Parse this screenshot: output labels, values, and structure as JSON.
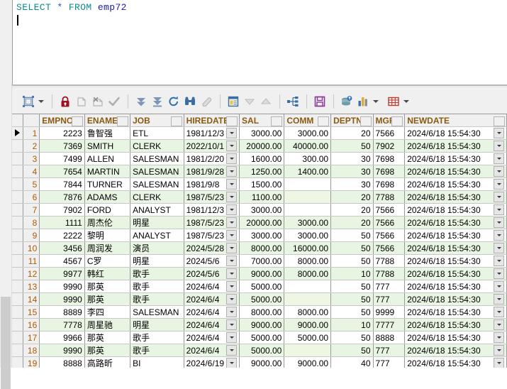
{
  "editor": {
    "sql_keyword1": "SELECT",
    "sql_star": "*",
    "sql_keyword2": "FROM",
    "sql_table": "emp72",
    "full_sql": "SELECT * FROM emp72"
  },
  "toolbar": {
    "buttons": [
      {
        "name": "edit-data-button",
        "icon": "edit-data-icon",
        "label": "Edit data"
      },
      {
        "name": "edit-data-dropdown",
        "icon": "chevron-down-icon",
        "label": "Edit data options"
      },
      {
        "name": "lock-button",
        "icon": "lock-icon",
        "label": "Lock"
      },
      {
        "name": "insert-record-button",
        "icon": "new-record-icon",
        "label": "Insert record"
      },
      {
        "name": "delete-record-button",
        "icon": "delete-record-icon",
        "label": "Delete record"
      },
      {
        "name": "post-edit-button",
        "icon": "checkmark-icon",
        "label": "Post edit"
      },
      {
        "name": "fetch-next-button",
        "icon": "fetch-next-icon",
        "label": "Fetch next page"
      },
      {
        "name": "fetch-all-button",
        "icon": "fetch-all-icon",
        "label": "Fetch all"
      },
      {
        "name": "refresh-button",
        "icon": "refresh-icon",
        "label": "Refresh"
      },
      {
        "name": "find-button",
        "icon": "binoculars-icon",
        "label": "Find"
      },
      {
        "name": "clear-filter-button",
        "icon": "eraser-icon",
        "label": "Clear filter"
      },
      {
        "name": "single-record-view-button",
        "icon": "form-view-icon",
        "label": "Single record view"
      },
      {
        "name": "move-down-button",
        "icon": "triangle-down-icon",
        "label": "Move down"
      },
      {
        "name": "move-up-button",
        "icon": "triangle-up-icon",
        "label": "Move up"
      },
      {
        "name": "hierarchy-button",
        "icon": "hierarchy-icon",
        "label": "Structure"
      },
      {
        "name": "export-button",
        "icon": "save-icon",
        "label": "Export"
      },
      {
        "name": "database-info-button",
        "icon": "database-icon",
        "label": "Database info"
      },
      {
        "name": "chart-button",
        "icon": "bar-chart-icon",
        "label": "Chart"
      },
      {
        "name": "chart-dropdown",
        "icon": "chevron-down-icon",
        "label": "Chart options"
      },
      {
        "name": "grid-button",
        "icon": "grid-icon",
        "label": "Grid"
      },
      {
        "name": "grid-dropdown",
        "icon": "chevron-down-icon",
        "label": "Grid options"
      }
    ]
  },
  "grid": {
    "columns": [
      "EMPNO",
      "ENAME",
      "JOB",
      "HIREDATE",
      "SAL",
      "COMM",
      "DEPTNO",
      "MGR",
      "NEWDATE"
    ],
    "current_row": 1,
    "rows": [
      {
        "n": "1",
        "EMPNO": "2223",
        "ENAME": "鲁智强",
        "JOB": "ETL",
        "HIREDATE": "1981/12/3",
        "SAL": "3000.00",
        "COMM": "3000.00",
        "DEPTNO": "20",
        "MGR": "7566",
        "NEWDATE": "2024/6/18 15:54:30"
      },
      {
        "n": "2",
        "EMPNO": "7369",
        "ENAME": "SMITH",
        "JOB": "CLERK",
        "HIREDATE": "2022/10/1",
        "SAL": "20000.00",
        "COMM": "40000.00",
        "DEPTNO": "50",
        "MGR": "7902",
        "NEWDATE": "2024/6/18 15:54:30"
      },
      {
        "n": "3",
        "EMPNO": "7499",
        "ENAME": "ALLEN",
        "JOB": "SALESMAN",
        "HIREDATE": "1981/2/20",
        "SAL": "1600.00",
        "COMM": "300.00",
        "DEPTNO": "30",
        "MGR": "7698",
        "NEWDATE": "2024/6/18 15:54:30"
      },
      {
        "n": "4",
        "EMPNO": "7654",
        "ENAME": "MARTIN",
        "JOB": "SALESMAN",
        "HIREDATE": "1981/9/28",
        "SAL": "1250.00",
        "COMM": "1400.00",
        "DEPTNO": "30",
        "MGR": "7698",
        "NEWDATE": "2024/6/18 15:54:30"
      },
      {
        "n": "5",
        "EMPNO": "7844",
        "ENAME": "TURNER",
        "JOB": "SALESMAN",
        "HIREDATE": "1981/9/8",
        "SAL": "1500.00",
        "COMM": "",
        "DEPTNO": "30",
        "MGR": "7698",
        "NEWDATE": "2024/6/18 15:54:30"
      },
      {
        "n": "6",
        "EMPNO": "7876",
        "ENAME": "ADAMS",
        "JOB": "CLERK",
        "HIREDATE": "1987/5/23",
        "SAL": "1100.00",
        "COMM": "",
        "DEPTNO": "20",
        "MGR": "7788",
        "NEWDATE": "2024/6/18 15:54:30"
      },
      {
        "n": "7",
        "EMPNO": "7902",
        "ENAME": "FORD",
        "JOB": "ANALYST",
        "HIREDATE": "1981/12/3",
        "SAL": "3000.00",
        "COMM": "",
        "DEPTNO": "20",
        "MGR": "7566",
        "NEWDATE": "2024/6/18 15:54:30"
      },
      {
        "n": "8",
        "EMPNO": "1111",
        "ENAME": "周杰伦",
        "JOB": "明星",
        "HIREDATE": "1987/5/23",
        "SAL": "20000.00",
        "COMM": "3000.00",
        "DEPTNO": "20",
        "MGR": "7566",
        "NEWDATE": "2024/6/18 15:54:30"
      },
      {
        "n": "9",
        "EMPNO": "2222",
        "ENAME": "黎明",
        "JOB": "ANALYST",
        "HIREDATE": "1987/5/23",
        "SAL": "3000.00",
        "COMM": "3000.00",
        "DEPTNO": "50",
        "MGR": "7566",
        "NEWDATE": "2024/6/18 15:54:30"
      },
      {
        "n": "10",
        "EMPNO": "3456",
        "ENAME": "周润发",
        "JOB": "演员",
        "HIREDATE": "2024/5/28",
        "SAL": "8000.00",
        "COMM": "16000.00",
        "DEPTNO": "50",
        "MGR": "7566",
        "NEWDATE": "2024/6/18 15:54:30"
      },
      {
        "n": "11",
        "EMPNO": "4567",
        "ENAME": "C罗",
        "JOB": "明星",
        "HIREDATE": "2024/5/6",
        "SAL": "7000.00",
        "COMM": "8000.00",
        "DEPTNO": "50",
        "MGR": "7788",
        "NEWDATE": "2024/6/18 15:54:30"
      },
      {
        "n": "12",
        "EMPNO": "9977",
        "ENAME": "韩红",
        "JOB": "歌手",
        "HIREDATE": "2024/5/6",
        "SAL": "9000.00",
        "COMM": "8000.00",
        "DEPTNO": "10",
        "MGR": "7788",
        "NEWDATE": "2024/6/18 15:54:30"
      },
      {
        "n": "13",
        "EMPNO": "9990",
        "ENAME": "那英",
        "JOB": "歌手",
        "HIREDATE": "2024/6/4",
        "SAL": "5000.00",
        "COMM": "",
        "DEPTNO": "50",
        "MGR": "777",
        "NEWDATE": "2024/6/18 15:54:30"
      },
      {
        "n": "14",
        "EMPNO": "9990",
        "ENAME": "那英",
        "JOB": "歌手",
        "HIREDATE": "2024/6/4",
        "SAL": "5000.00",
        "COMM": "",
        "DEPTNO": "50",
        "MGR": "777",
        "NEWDATE": "2024/6/18 15:54:30"
      },
      {
        "n": "15",
        "EMPNO": "8889",
        "ENAME": "李四",
        "JOB": "SALESMAN",
        "HIREDATE": "2024/6/4",
        "SAL": "8000.00",
        "COMM": "8000.00",
        "DEPTNO": "50",
        "MGR": "9999",
        "NEWDATE": "2024/6/18 15:54:30"
      },
      {
        "n": "16",
        "EMPNO": "7778",
        "ENAME": "周星驰",
        "JOB": "明星",
        "HIREDATE": "2024/6/4",
        "SAL": "9000.00",
        "COMM": "9000.00",
        "DEPTNO": "10",
        "MGR": "7777",
        "NEWDATE": "2024/6/18 15:54:30"
      },
      {
        "n": "17",
        "EMPNO": "9966",
        "ENAME": "那英",
        "JOB": "歌手",
        "HIREDATE": "2024/6/4",
        "SAL": "5000.00",
        "COMM": "5000.00",
        "DEPTNO": "50",
        "MGR": "8888",
        "NEWDATE": "2024/6/18 15:54:30"
      },
      {
        "n": "18",
        "EMPNO": "9990",
        "ENAME": "那英",
        "JOB": "歌手",
        "HIREDATE": "2024/6/4",
        "SAL": "5000.00",
        "COMM": "",
        "DEPTNO": "50",
        "MGR": "777",
        "NEWDATE": "2024/6/18 15:54:30"
      },
      {
        "n": "19",
        "EMPNO": "8888",
        "ENAME": "高路昕",
        "JOB": "BI",
        "HIREDATE": "2024/6/19",
        "SAL": "9000.00",
        "COMM": "9000.00",
        "DEPTNO": "40",
        "MGR": "777",
        "NEWDATE": "2024/6/18 15:54:30"
      }
    ]
  },
  "colors": {
    "header_text": "#8a5a10",
    "row_number": "#b05a00",
    "alt_row": "#e8f5e2",
    "null_cell": "#fdfbe0",
    "keyword": "#0b8a8a",
    "table_name": "#1a1aa6",
    "lock": "#a01020"
  }
}
